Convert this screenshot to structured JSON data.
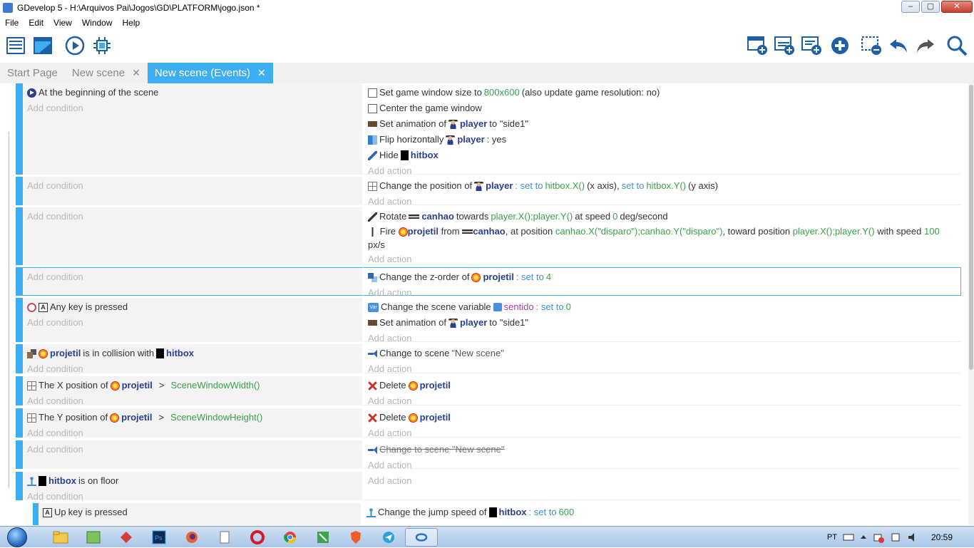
{
  "window": {
    "title": "GDevelop 5 - H:\\Arquivos Pai\\Jogos\\GD\\PLATFORM\\jogo.json *",
    "min": "–",
    "max": "▢",
    "close": "✕"
  },
  "menu": [
    "File",
    "Edit",
    "View",
    "Window",
    "Help"
  ],
  "tabs": [
    {
      "label": "Start Page",
      "closable": false
    },
    {
      "label": "New scene",
      "closable": true
    },
    {
      "label": "New scene (Events)",
      "closable": true,
      "active": true
    }
  ],
  "tab_close_glyph": "✕",
  "placeholders": {
    "condition": "Add condition",
    "action": "Add action"
  },
  "events": {
    "e1": {
      "cond": "At the beginning of the scene",
      "a1": {
        "t1": "Set game window size to",
        "v1": "800x600",
        "t2": "(also update game resolution: no)"
      },
      "a2": "Center the game window",
      "a3": {
        "t1": "Set animation of",
        "obj": "player",
        "t2": "to \"side1\""
      },
      "a4": {
        "t1": "Flip horizontally",
        "obj": "player",
        "t2": ": yes"
      },
      "a5": {
        "t1": "Hide",
        "obj": "hitbox"
      }
    },
    "e2": {
      "a1": {
        "t1": "Change the position of",
        "obj": "player",
        "op1": ": set to",
        "v1": "hitbox.X()",
        "t2": "(x axis),",
        "op2": "set to",
        "v2": "hitbox.Y()",
        "t3": "(y axis)"
      }
    },
    "e3": {
      "a1": {
        "t1": "Rotate",
        "obj": "canhao",
        "t2": "towards",
        "v1": "player.X();player.Y()",
        "t3": "at speed",
        "v2": "0",
        "t4": "deg/second"
      },
      "a2": {
        "t1": "Fire",
        "obj1": "projetil",
        "t2": "from",
        "obj2": "canhao",
        "t3": ", at position",
        "v1": "canhao.X(\"disparo\");canhao.Y(\"disparo\")",
        "t4": ", toward position",
        "v2": "player.X();player.Y()",
        "t5": "with speed",
        "v3": "100",
        "t6": "px/s"
      }
    },
    "e4": {
      "a1": {
        "t1": "Change the z-order of",
        "obj": "projetil",
        "op": ": set to",
        "v": "4"
      }
    },
    "e5": {
      "cond": "Any key is pressed",
      "a1": {
        "t1": "Change the scene variable",
        "var": "sentido",
        "op": ": set to",
        "v": "0"
      },
      "a2": {
        "t1": "Set animation of",
        "obj": "player",
        "t2": "to \"side1\""
      }
    },
    "e6": {
      "cond": {
        "obj1": "projetil",
        "t1": "is in collision with",
        "obj2": "hitbox"
      },
      "a1": {
        "t1": "Change to scene",
        "t2": "\"New scene\""
      }
    },
    "e7": {
      "cond": {
        "t1": "The X position of",
        "obj": "projetil",
        "op": ">",
        "v": "SceneWindowWidth()"
      },
      "a1": {
        "t1": "Delete",
        "obj": "projetil"
      }
    },
    "e8": {
      "cond": {
        "t1": "The Y position of",
        "obj": "projetil",
        "op": ">",
        "v": "SceneWindowHeight()"
      },
      "a1": {
        "t1": "Delete",
        "obj": "projetil"
      }
    },
    "e9": {
      "a1": "Change to scene \"New scene\""
    },
    "e10": {
      "cond": {
        "obj": "hitbox",
        "t1": "is on floor"
      }
    },
    "e11": {
      "cond": {
        "t1": "Up",
        "t2": "key is pressed"
      },
      "a1": {
        "t1": "Change the jump speed of",
        "obj": "hitbox",
        "op": ": set to",
        "v": "600"
      }
    }
  },
  "key_glyph": "A",
  "scene_var_glyph": "Var",
  "tray": {
    "lang": "PT",
    "clock": "20:59"
  },
  "colors": {
    "accent": "#3eaef2",
    "object": "#2a3f8f",
    "operator": "#3b8fd6",
    "value": "#3aa14a",
    "variable": "#a43fb0"
  }
}
